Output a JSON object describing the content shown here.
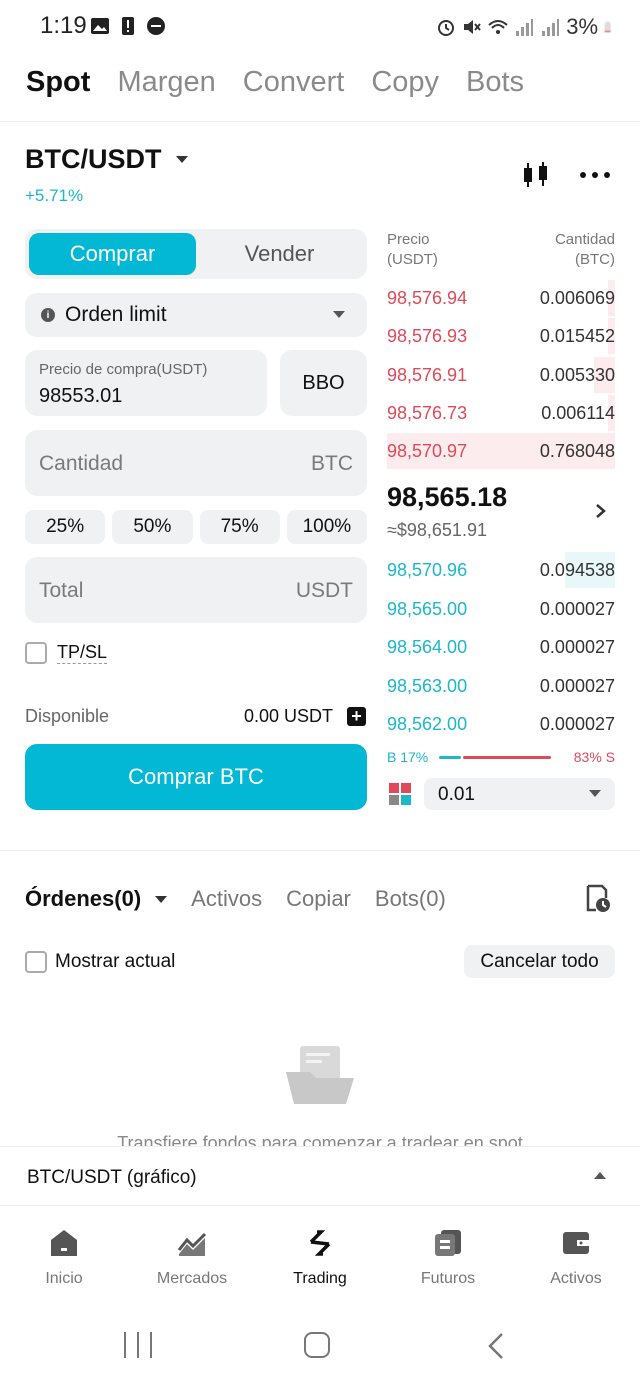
{
  "status_bar": {
    "time": "1:19",
    "battery": "3%"
  },
  "top_tabs": [
    "Spot",
    "Margen",
    "Convert",
    "Copy",
    "Bots"
  ],
  "pair": {
    "symbol": "BTC/USDT",
    "change": "+5.71%"
  },
  "trade_form": {
    "buy_tab": "Comprar",
    "sell_tab": "Vender",
    "order_type": "Orden limit",
    "price_label": "Precio de compra(USDT)",
    "price_value": "98553.01",
    "bbo_label": "BBO",
    "amount_placeholder": "Cantidad",
    "amount_unit": "BTC",
    "percent_buttons": [
      "25%",
      "50%",
      "75%",
      "100%"
    ],
    "total_placeholder": "Total",
    "total_unit": "USDT",
    "tpsl_label": "TP/SL",
    "available_label": "Disponible",
    "available_value": "0.00 USDT",
    "submit_label": "Comprar BTC"
  },
  "order_book": {
    "price_header_1": "Precio",
    "price_header_2": "(USDT)",
    "qty_header_1": "Cantidad",
    "qty_header_2": "(BTC)",
    "asks": [
      {
        "price": "98,576.94",
        "qty": "0.006069",
        "depth": 0.03
      },
      {
        "price": "98,576.93",
        "qty": "0.015452",
        "depth": 0.03
      },
      {
        "price": "98,576.91",
        "qty": "0.005330",
        "depth": 0.09
      },
      {
        "price": "98,576.73",
        "qty": "0.006114",
        "depth": 0.03
      },
      {
        "price": "98,570.97",
        "qty": "0.768048",
        "depth": 1.0
      }
    ],
    "mid_price": "98,565.18",
    "mid_usd": "≈$98,651.91",
    "bids": [
      {
        "price": "98,570.96",
        "qty": "0.094538",
        "depth": 0.22
      },
      {
        "price": "98,565.00",
        "qty": "0.000027",
        "depth": 0
      },
      {
        "price": "98,564.00",
        "qty": "0.000027",
        "depth": 0
      },
      {
        "price": "98,563.00",
        "qty": "0.000027",
        "depth": 0
      },
      {
        "price": "98,562.00",
        "qty": "0.000027",
        "depth": 0
      }
    ],
    "buy_ratio": "B 17%",
    "sell_ratio": "83% S",
    "depth_value": "0.01"
  },
  "orders": {
    "tabs": [
      "Órdenes(0)",
      "Activos",
      "Copiar",
      "Bots(0)"
    ],
    "show_current": "Mostrar actual",
    "cancel_all": "Cancelar todo",
    "empty_text": "Transfiere fondos para comenzar a tradear en spot"
  },
  "chart_bar": {
    "label": "BTC/USDT (gráfico)"
  },
  "bottom_nav": [
    "Inicio",
    "Mercados",
    "Trading",
    "Futuros",
    "Activos"
  ],
  "colors": {
    "accent": "#02b8d4",
    "bid": "#1cb7c9",
    "ask": "#e0495a"
  }
}
